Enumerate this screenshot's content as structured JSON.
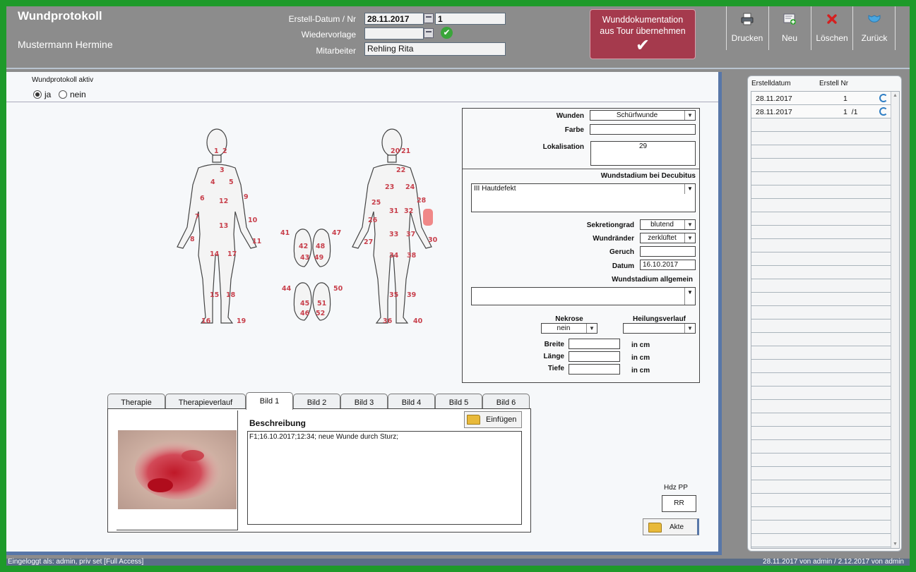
{
  "header": {
    "title": "Wundprotokoll",
    "patient": "Mustermann Hermine",
    "erstell_label": "Erstell-Datum / Nr",
    "erstell_date": "28.11.2017",
    "erstell_nr": "1",
    "wiedervorlage_label": "Wiedervorlage",
    "wiedervorlage_value": "",
    "mitarbeiter_label": "Mitarbeiter",
    "mitarbeiter_value": "Rehling Rita",
    "tour_button": [
      "Wunddokumentation",
      "aus Tour übernehmen"
    ],
    "toolbar": [
      {
        "label": "Drucken",
        "icon": "printer-icon"
      },
      {
        "label": "Neu",
        "icon": "new-document-icon"
      },
      {
        "label": "Löschen",
        "icon": "delete-icon"
      },
      {
        "label": "Zurück",
        "icon": "back-icon"
      }
    ]
  },
  "protocol_active": {
    "label": "Wundprotokoll aktiv",
    "options": [
      "ja",
      "nein"
    ],
    "selected": "ja"
  },
  "form": {
    "wunden_label": "Wunden",
    "wunden_value": "Schürfwunde",
    "farbe_label": "Farbe",
    "farbe_value": "",
    "lokalisation_label": "Lokalisation",
    "lokalisation_value": "29",
    "decubitus_label": "Wundstadium bei Decubitus",
    "decubitus_value": "III Hautdefekt",
    "sekretion_label": "Sekretiongrad",
    "sekretion_value": "blutend",
    "raender_label": "Wundränder",
    "raender_value": "zerklüftet",
    "geruch_label": "Geruch",
    "geruch_value": "",
    "datum_label": "Datum",
    "datum_value": "16.10.2017",
    "allgemein_label": "Wundstadium allgemein",
    "allgemein_value": "",
    "nekrose_label": "Nekrose",
    "nekrose_value": "nein",
    "heilung_label": "Heilungsverlauf",
    "heilung_value": "",
    "breite_label": "Breite",
    "laenge_label": "Länge",
    "tiefe_label": "Tiefe",
    "unit": "in cm"
  },
  "body_map": {
    "front": [
      "1",
      "2",
      "3",
      "4",
      "5",
      "6",
      "7",
      "8",
      "9",
      "10",
      "11",
      "12",
      "13",
      "14",
      "15",
      "16",
      "17",
      "18",
      "19"
    ],
    "back": [
      "20",
      "21",
      "22",
      "23",
      "24",
      "25",
      "26",
      "27",
      "28",
      "29",
      "30",
      "31",
      "32",
      "33",
      "34",
      "35",
      "36",
      "37",
      "38",
      "39",
      "40"
    ],
    "feet": [
      "41",
      "42",
      "43",
      "44",
      "45",
      "46",
      "47",
      "48",
      "49",
      "50",
      "51",
      "52"
    ],
    "highlighted": "29"
  },
  "tabs": [
    "Therapie",
    "Therapieverlauf",
    "Bild 1",
    "Bild 2",
    "Bild 3",
    "Bild 4",
    "Bild 5",
    "Bild 6"
  ],
  "active_tab": "Bild 1",
  "bild": {
    "beschreibung_label": "Beschreibung",
    "einfuegen_label": "Einfügen",
    "text": "F1;16.10.2017;12:34; neue Wunde durch Sturz;"
  },
  "hdz": {
    "label": "Hdz PP",
    "value": "RR",
    "akte_label": "Akte"
  },
  "list": {
    "headers": [
      "Erstelldatum",
      "Erstell Nr"
    ],
    "rows": [
      {
        "date": "28.11.2017",
        "nr": "1"
      },
      {
        "date": "28.11.2017",
        "nr": "1  /1"
      }
    ]
  },
  "status": {
    "left": "Eingeloggt als: admin, priv set [Full Access]",
    "right": "28.11.2017 von admin / 2.12.2017 von admin"
  },
  "colors": {
    "frame": "#1e9a2a",
    "header": "#8c8c8c",
    "tour_button": "#a53a4d",
    "accent_blue": "#5877a8",
    "body_numbers": "#c8404c"
  }
}
